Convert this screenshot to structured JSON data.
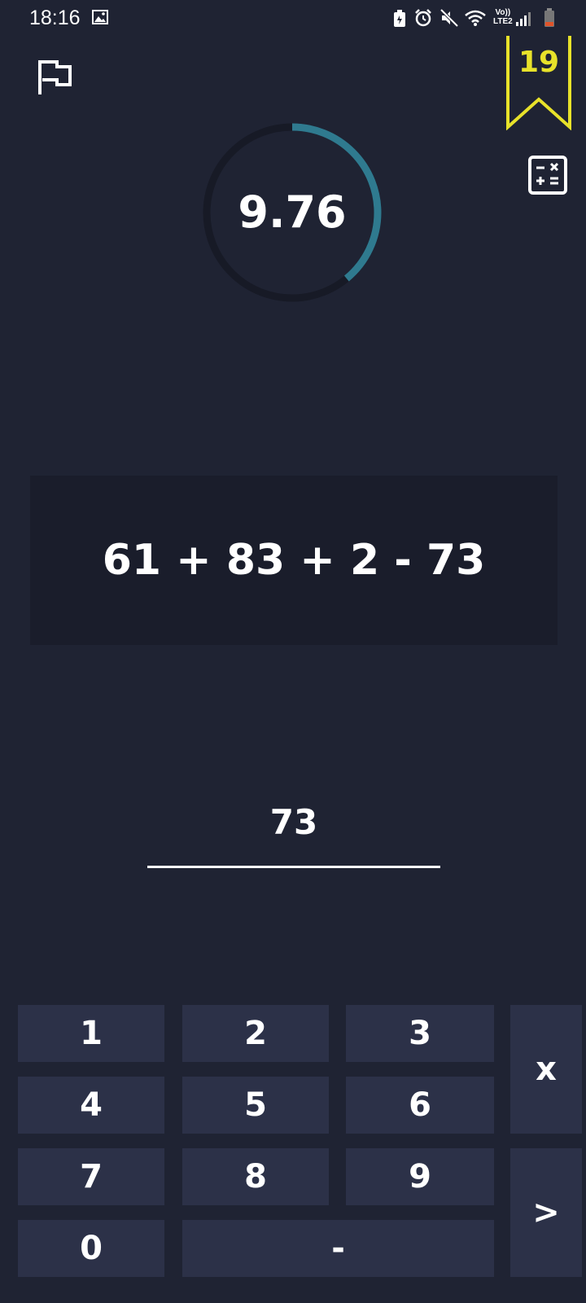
{
  "status_bar": {
    "time": "18:16",
    "icons": [
      "gallery-icon",
      "battery-saver-icon",
      "alarm-icon",
      "mute-icon",
      "wifi-icon",
      "volte-icon",
      "signal-icon",
      "battery-icon"
    ],
    "volte_label": "Vo))",
    "lte_label": "LTE2"
  },
  "header": {
    "flag_icon": "flag-icon",
    "streak_value": "19",
    "streak_color": "#e8e22a",
    "calculator_icon": "calculator-icon"
  },
  "timer": {
    "value": "9.76",
    "progress_fraction": 0.39,
    "ring_color": "#2f7a8f",
    "track_color": "#171a26"
  },
  "question": {
    "expression": "61 + 83 + 2 - 73"
  },
  "answer": {
    "value": "73"
  },
  "keypad": {
    "keys": {
      "k1": "1",
      "k2": "2",
      "k3": "3",
      "k4": "4",
      "k5": "5",
      "k6": "6",
      "k7": "7",
      "k8": "8",
      "k9": "9",
      "k0": "0",
      "minus": "-",
      "clear": "x",
      "submit": ">"
    }
  },
  "colors": {
    "background": "#1f2333",
    "question_bg": "#1a1d2b",
    "key_bg": "#2c3148"
  }
}
